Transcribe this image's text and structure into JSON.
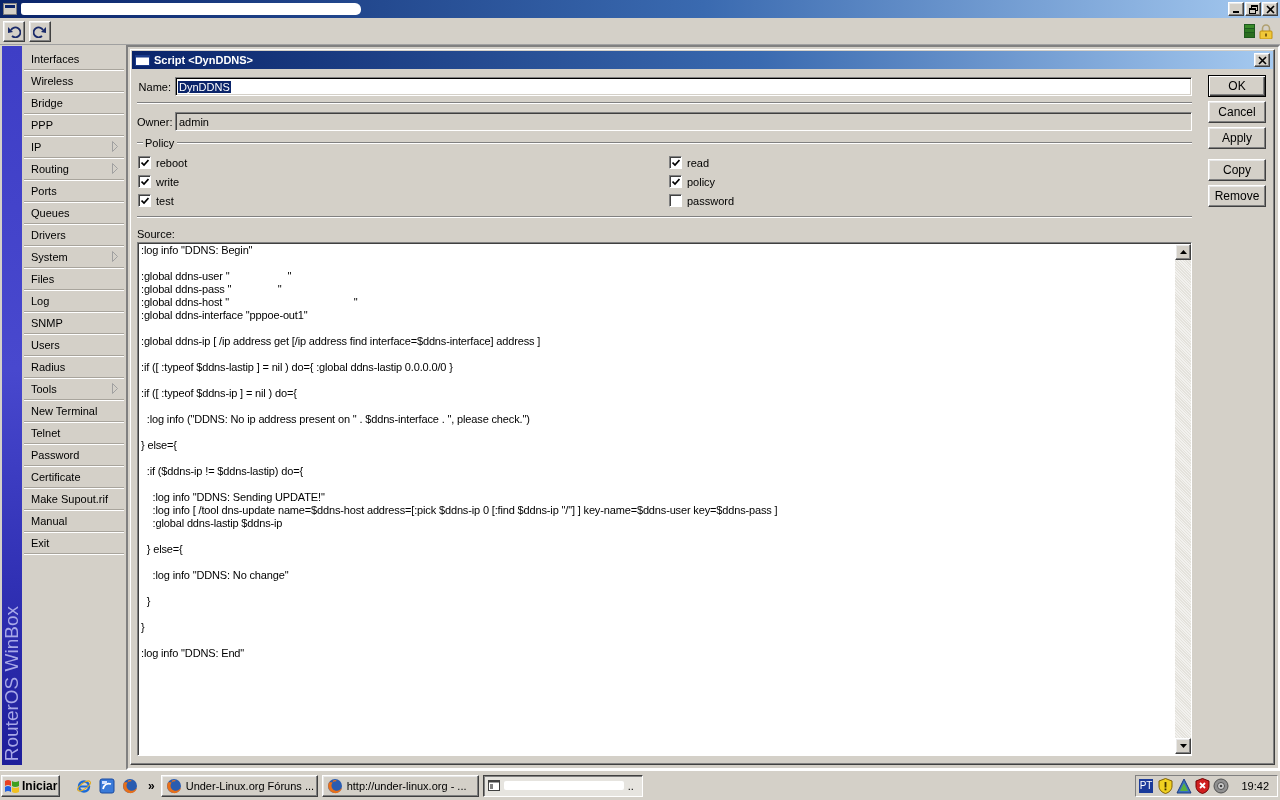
{
  "sidebar": {
    "brand": "RouterOS WinBox",
    "items": [
      {
        "label": "Interfaces",
        "submenu": false
      },
      {
        "label": "Wireless",
        "submenu": false
      },
      {
        "label": "Bridge",
        "submenu": false
      },
      {
        "label": "PPP",
        "submenu": false
      },
      {
        "label": "IP",
        "submenu": true
      },
      {
        "label": "Routing",
        "submenu": true
      },
      {
        "label": "Ports",
        "submenu": false
      },
      {
        "label": "Queues",
        "submenu": false
      },
      {
        "label": "Drivers",
        "submenu": false
      },
      {
        "label": "System",
        "submenu": true
      },
      {
        "label": "Files",
        "submenu": false
      },
      {
        "label": "Log",
        "submenu": false
      },
      {
        "label": "SNMP",
        "submenu": false
      },
      {
        "label": "Users",
        "submenu": false
      },
      {
        "label": "Radius",
        "submenu": false
      },
      {
        "label": "Tools",
        "submenu": true
      },
      {
        "label": "New Terminal",
        "submenu": false
      },
      {
        "label": "Telnet",
        "submenu": false
      },
      {
        "label": "Password",
        "submenu": false
      },
      {
        "label": "Certificate",
        "submenu": false
      },
      {
        "label": "Make Supout.rif",
        "submenu": false
      },
      {
        "label": "Manual",
        "submenu": false
      },
      {
        "label": "Exit",
        "submenu": false
      }
    ]
  },
  "dialog": {
    "title": "Script <DynDDNS>",
    "fields": [
      {
        "label": "Name:",
        "value": "DynDDNS",
        "focused": true,
        "text_selected": true,
        "disabled": false
      },
      {
        "label": "Owner:",
        "value": "admin",
        "focused": false,
        "text_selected": false,
        "disabled": true
      }
    ],
    "policy": {
      "title": "Policy",
      "options": [
        {
          "label": "reboot",
          "checked": true
        },
        {
          "label": "write",
          "checked": true
        },
        {
          "label": "test",
          "checked": true
        },
        {
          "label": "read",
          "checked": true
        },
        {
          "label": "policy",
          "checked": true
        },
        {
          "label": "password",
          "checked": false
        }
      ]
    },
    "source": {
      "label": "Source:",
      "text": ":log info \"DDNS: Begin\"\n\n:global ddns-user \"                    \"\n:global ddns-pass \"                \"\n:global ddns-host \"                                           \"\n:global ddns-interface \"pppoe-out1\"\n\n:global ddns-ip [ /ip address get [/ip address find interface=$ddns-interface] address ]\n\n:if ([ :typeof $ddns-lastip ] = nil ) do={ :global ddns-lastip 0.0.0.0/0 }\n\n:if ([ :typeof $ddns-ip ] = nil ) do={\n\n  :log info (\"DDNS: No ip address present on \" . $ddns-interface . \", please check.\")\n\n} else={\n\n  :if ($ddns-ip != $ddns-lastip) do={\n\n    :log info \"DDNS: Sending UPDATE!\"\n    :log info [ /tool dns-update name=$ddns-host address=[:pick $ddns-ip 0 [:find $ddns-ip \"/\"] ] key-name=$ddns-user key=$ddns-pass ]\n    :global ddns-lastip $ddns-ip\n\n  } else={\n\n    :log info \"DDNS: No change\"\n\n  }\n\n}\n\n:log info \"DDNS: End\""
    },
    "button_groups": [
      [
        {
          "label": "OK",
          "default": true
        },
        {
          "label": "Cancel",
          "default": false
        },
        {
          "label": "Apply",
          "default": false
        }
      ],
      [
        {
          "label": "Copy",
          "default": false
        },
        {
          "label": "Remove",
          "default": false
        }
      ]
    ]
  },
  "taskbar": {
    "start": "Iniciar",
    "more": "»",
    "tasks": [
      {
        "label": "Under-Linux.org Fóruns ...",
        "selected": false
      },
      {
        "label": "http://under-linux.org - ...",
        "selected": false
      },
      {
        "label": "..",
        "selected": true
      }
    ],
    "language": "PT",
    "clock": "19:42"
  }
}
